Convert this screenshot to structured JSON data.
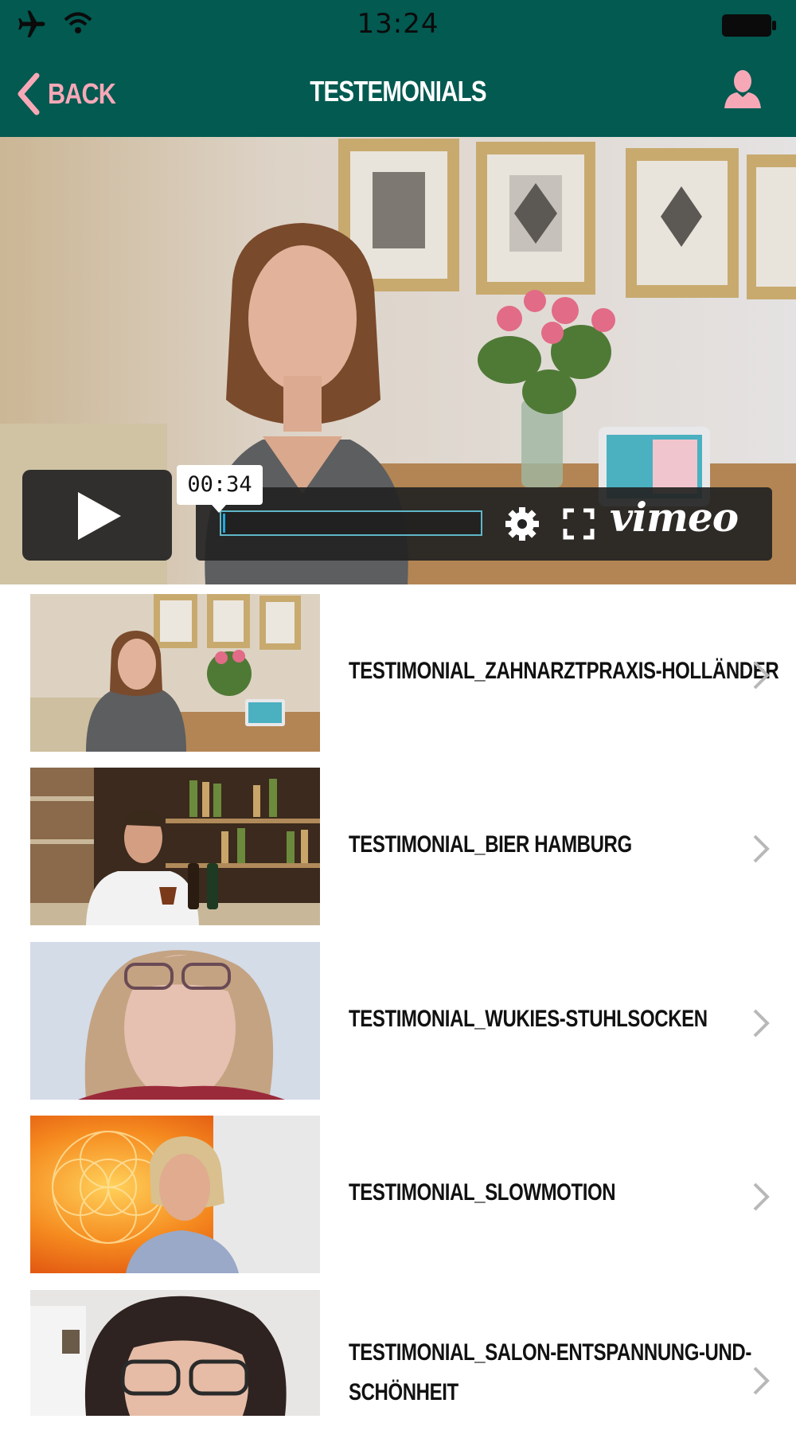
{
  "status_bar": {
    "time": "13:24",
    "icons": [
      "airplane-icon",
      "wifi-icon",
      "battery-icon"
    ]
  },
  "nav": {
    "back_label": "BACK",
    "title": "TESTEMONIALS",
    "right_icon": "profile-icon"
  },
  "player": {
    "time_label": "00:34",
    "brand": "vimeo",
    "progress": 0.0,
    "controls": [
      "play-icon",
      "settings-icon",
      "fullscreen-icon"
    ]
  },
  "videos": [
    {
      "label_line1": "TESTIMONIAL_ZAHNARZTPRAXIS-HOLLÄNDER",
      "label_line2": ""
    },
    {
      "label_line1": "TESTIMONIAL_BIER HAMBURG",
      "label_line2": ""
    },
    {
      "label_line1": "TESTIMONIAL_WUKIES-STUHLSOCKEN",
      "label_line2": ""
    },
    {
      "label_line1": "TESTIMONIAL_SLOWMOTION",
      "label_line2": ""
    },
    {
      "label_line1": "TESTIMONIAL_SALON-ENTSPANNUNG-UND-",
      "label_line2": "SCHÖNHEIT"
    }
  ],
  "colors": {
    "header_bg": "#025a51",
    "accent_pink": "#f7a8b7",
    "title_text": "#ffffff",
    "chevron": "#b8b8b8"
  }
}
